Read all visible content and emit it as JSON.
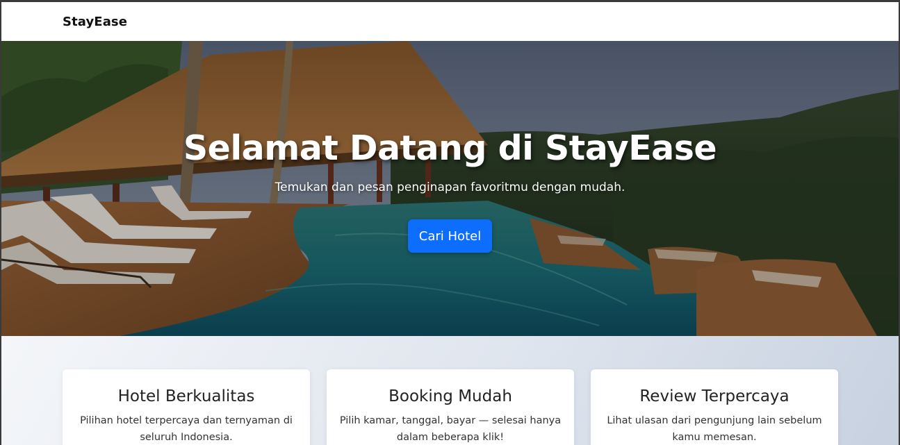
{
  "navbar": {
    "brand": "StayEase"
  },
  "hero": {
    "title": "Selamat Datang di StayEase",
    "subtitle": "Temukan dan pesan penginapan favoritmu dengan mudah.",
    "cta_label": "Cari Hotel"
  },
  "features": [
    {
      "title": "Hotel Berkualitas",
      "description": "Pilihan hotel terpercaya dan ternyaman di seluruh Indonesia."
    },
    {
      "title": "Booking Mudah",
      "description": "Pilih kamar, tanggal, bayar — selesai hanya dalam beberapa klik!"
    },
    {
      "title": "Review Terpercaya",
      "description": "Lihat ulasan dari pengunjung lain sebelum kamu memesan."
    }
  ],
  "colors": {
    "primary": "#0d6efd",
    "navbar_bg": "#ffffff",
    "text_dark": "#222222"
  }
}
